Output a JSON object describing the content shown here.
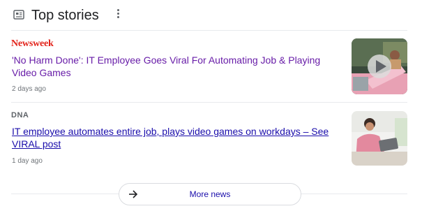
{
  "header": {
    "title": "Top stories",
    "icon": "news-icon"
  },
  "stories": [
    {
      "source": "Newsweek",
      "headline": "'No Harm Done': IT Employee Goes Viral For Automating Job & Playing Video Games",
      "time": "2 days ago",
      "headline_color": "#681da8",
      "thumbnail": "video-thumbnail",
      "has_play_button": true
    },
    {
      "source": "DNA",
      "headline": "IT employee automates entire job, plays video games on workdays – See VIRAL post",
      "time": "1 day ago",
      "headline_color": "#1a0dab",
      "thumbnail": "image-thumbnail"
    }
  ],
  "more_news": {
    "label": "More news",
    "icon": "arrow-right-icon"
  },
  "colors": {
    "accent": "#1a0dab",
    "visited": "#681da8",
    "newsweek": "#e2231a",
    "divider": "#e8eaed"
  }
}
